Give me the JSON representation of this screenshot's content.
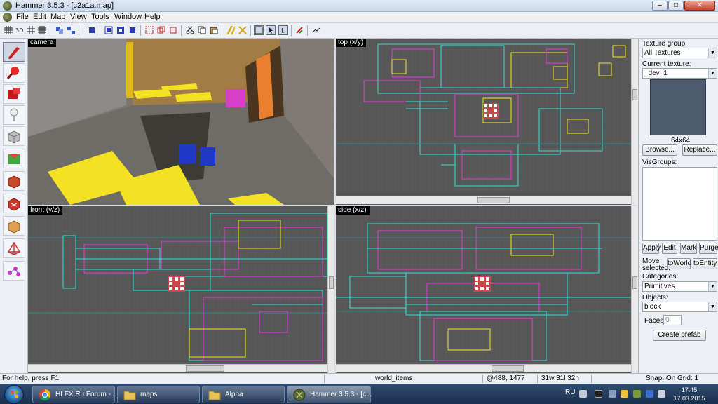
{
  "window": {
    "title": "Hammer 3.5.3 - [c2a1a.map]",
    "min": "–",
    "max": "□",
    "close": "✕"
  },
  "menu": [
    "File",
    "Edit",
    "Map",
    "View",
    "Tools",
    "Window",
    "Help"
  ],
  "viewports": {
    "camera": "camera",
    "top": "top (x/y)",
    "front": "front (y/z)",
    "side": "side (x/z)"
  },
  "colors": {
    "grid_bg": "#575757",
    "brush_cyan": "#2fe0d8",
    "brush_magenta": "#e83ad8",
    "brush_yellow": "#f2e626",
    "grid_line": "#6a6a6a",
    "axis": "#2d8a8a"
  },
  "right_panel": {
    "texture_group_label": "Texture group:",
    "texture_group_value": "All Textures",
    "current_texture_label": "Current texture:",
    "current_texture_value": "_dev_1",
    "texture_size": "64x64",
    "browse": "Browse...",
    "replace": "Replace...",
    "visgroups_label": "VisGroups:",
    "apply": "Apply",
    "edit": "Edit",
    "mark": "Mark",
    "purge": "Purge",
    "move_label_1": "Move",
    "move_label_2": "selected:",
    "to_world": "toWorld",
    "to_entity": "toEntity",
    "categories_label": "Categories:",
    "categories_value": "Primitives",
    "objects_label": "Objects:",
    "objects_value": "block",
    "faces_label": "Faces:",
    "faces_value": "0",
    "create_prefab": "Create prefab"
  },
  "status": {
    "help": "For help, press F1",
    "selection": "world_items",
    "coords": "@488, 1477",
    "size": "31w 31l 32h",
    "snap": "Snap: On Grid: 1"
  },
  "taskbar": {
    "tasks": [
      "HLFX.Ru Forum - ...",
      "maps",
      "Alpha",
      "Hammer 3.5.3 - [c..."
    ],
    "lang": "RU",
    "time": "17:45",
    "date": "17.03.2015"
  }
}
